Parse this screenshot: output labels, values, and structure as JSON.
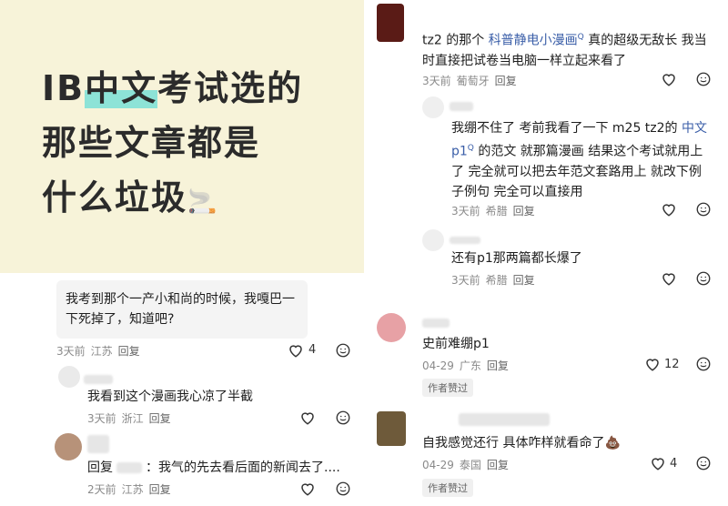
{
  "poster": {
    "line1_prefix": "IB",
    "line1_highlight": "中文",
    "line1_suffix": "考试选的",
    "line2": "那些文章都是",
    "line3": "什么垃圾",
    "emoji": "🚬"
  },
  "left_comments": [
    {
      "text": "我考到那个一产小和尚的时候，我嘎巴一下死掉了，知道吧?",
      "time": "3天前",
      "location": "江苏",
      "reply": "回复",
      "likes": "4"
    },
    {
      "text": "我看到这个漫画我心凉了半截",
      "time": "3天前",
      "location": "浙江",
      "reply": "回复"
    },
    {
      "prefix": "回复",
      "text": "：我气的先去看后面的新闻去了....",
      "time": "2天前",
      "location": "江苏",
      "reply": "回复"
    }
  ],
  "right_comments": [
    {
      "text_a": "tz2 的那个 ",
      "link": "科普静电小漫画",
      "text_b": " 真的超级无敌长 我当时直接把试卷当电脑一样立起来看了",
      "time": "3天前",
      "location": "葡萄牙",
      "reply": "回复"
    },
    {
      "text_a": "我绷不住了 考前我看了一下 m25 tz2的 ",
      "link": "中文p1",
      "text_b": " 的范文 就那篇漫画 结果这个考试就用上了 完全就可以把去年范文套路用上 就改下例子例句 完全可以直接用",
      "time": "3天前",
      "location": "希腊",
      "reply": "回复"
    },
    {
      "text": "还有p1那两篇都长爆了",
      "time": "3天前",
      "location": "希腊",
      "reply": "回复"
    },
    {
      "text": "史前难绷p1",
      "time": "04-29",
      "location": "广东",
      "reply": "回复",
      "likes": "12",
      "badge": "作者赞过"
    },
    {
      "text": "自我感觉还行 具体咋样就看命了💩",
      "time": "04-29",
      "location": "泰国",
      "reply": "回复",
      "likes": "4",
      "badge": "作者赞过"
    }
  ]
}
